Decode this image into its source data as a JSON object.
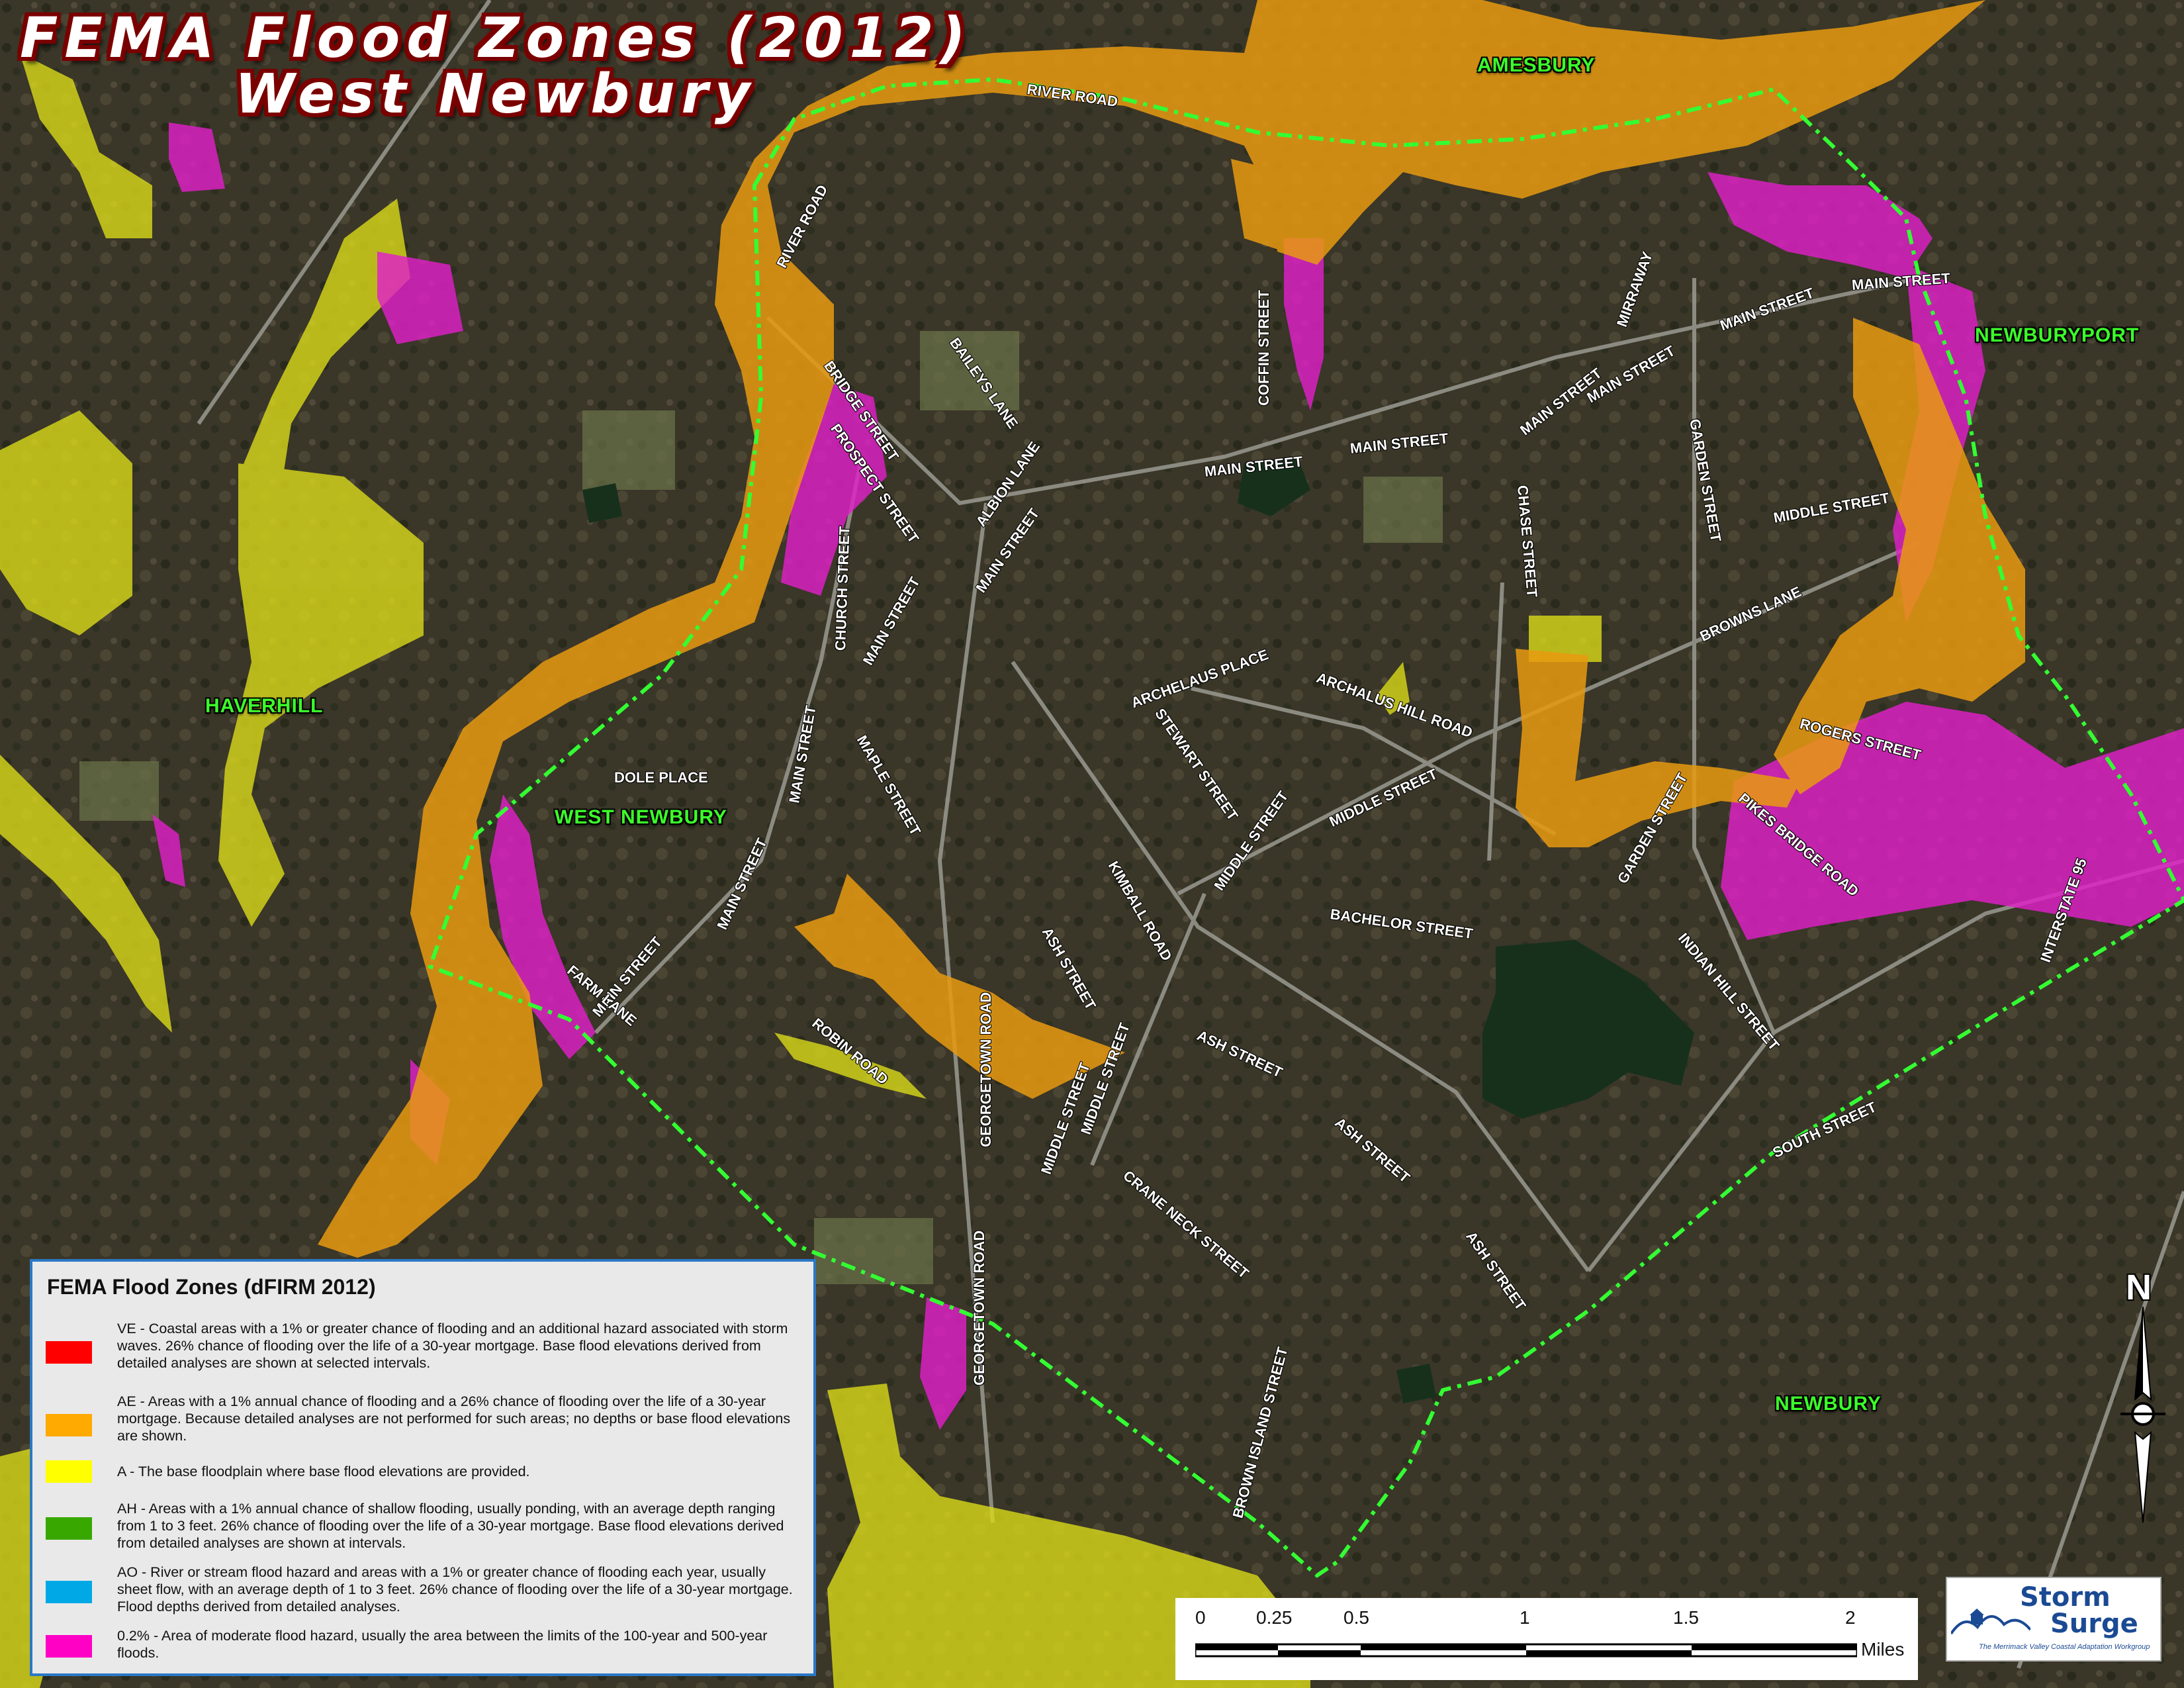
{
  "title": {
    "line1": "FEMA Flood Zones (2012)",
    "line2": "West Newbury"
  },
  "towns": {
    "amesbury": "AMESBURY",
    "newburyport": "NEWBURYPORT",
    "haverhill": "HAVERHILL",
    "west_newbury": "WEST NEWBURY",
    "newbury": "NEWBURY"
  },
  "streets": [
    "RIVER ROAD",
    "RIVER ROAD",
    "BRIDGE STREET",
    "PROSPECT STREET",
    "BAILEYS LANE",
    "ALBION LANE",
    "MAIN STREET",
    "MAIN STREET",
    "MAIN STREET",
    "MAIN STREET",
    "COFFIN STREET",
    "MAIN STREET",
    "MIRRAWAY",
    "MAIN STREET",
    "MAIN STREET",
    "GARDEN STREET",
    "CHASE STREET",
    "MIDDLE STREET",
    "BROWNS LANE",
    "CHURCH STREET",
    "MAIN STREET",
    "ARCHELAUS PLACE",
    "ARCHALUS HILL ROAD",
    "STEWART STREET",
    "MIDDLE STREET",
    "MIDDLE STREET",
    "ROGERS STREET",
    "PIKES BRIDGE ROAD",
    "GARDEN STREET",
    "MAPLE STREET",
    "MAIN STREET",
    "DOLE PLACE",
    "MAIN STREET",
    "MAIN STREET",
    "FARM LANE",
    "KIMBALL ROAD",
    "MIDDLE STREET",
    "BACHELOR STREET",
    "INDIAN HILL STREET",
    "INTERSTATE 95",
    "ASH STREET",
    "ASH STREET",
    "ASH STREET",
    "ASH STREET",
    "ROBIN ROAD",
    "GEORGETOWN ROAD",
    "MIDDLE STREET",
    "CRANE NECK STREET",
    "SOUTH STREET",
    "GEORGETOWN ROAD",
    "BROWN ISLAND STREET"
  ],
  "legend": {
    "title": "FEMA Flood Zones (dFIRM 2012)",
    "items": [
      {
        "color": "#ff0000",
        "text": "VE - Coastal areas with a 1% or greater chance of flooding and an additional hazard associated with storm waves. 26% chance of flooding over the life of a 30-year mortgage. Base flood elevations derived from detailed analyses are shown at selected intervals."
      },
      {
        "color": "#ffaa00",
        "text": "AE - Areas with a 1% annual chance of flooding and a 26% chance of flooding over the life of a 30-year mortgage. Because detailed analyses are not performed for such areas; no depths or base flood elevations are shown."
      },
      {
        "color": "#ffff00",
        "text": "A - The base floodplain where base flood elevations are provided."
      },
      {
        "color": "#38a800",
        "text": "AH - Areas with a 1% annual chance of shallow flooding, usually ponding, with an average depth ranging from 1 to 3 feet. 26% chance of flooding over the life of a 30-year mortgage. Base flood elevations derived from detailed analyses are shown at intervals."
      },
      {
        "color": "#00a9e6",
        "text": "AO - River or stream flood hazard and areas with a 1% or greater chance of flooding each year, usually sheet flow, with an average depth of 1 to 3 feet. 26% chance of flooding over the life of a 30-year mortgage. Flood depths derived from detailed analyses."
      },
      {
        "color": "#ff00c5",
        "text": "0.2% - Area of moderate flood hazard, usually the area between the limits of the 100-year and 500-year floods."
      }
    ]
  },
  "scale": {
    "labels": [
      "0",
      "0.25",
      "0.5",
      "1",
      "1.5",
      "2"
    ],
    "unit": "Miles"
  },
  "north": "N",
  "logo": {
    "line1": "Storm",
    "line2": "Surge",
    "sub": "The Merrimack Valley Coastal Adaptation Workgroup"
  },
  "colors": {
    "ae": "#e89a10",
    "a": "#dede1a",
    "shaded_x": "#e020c8",
    "boundary": "#33ff33"
  }
}
